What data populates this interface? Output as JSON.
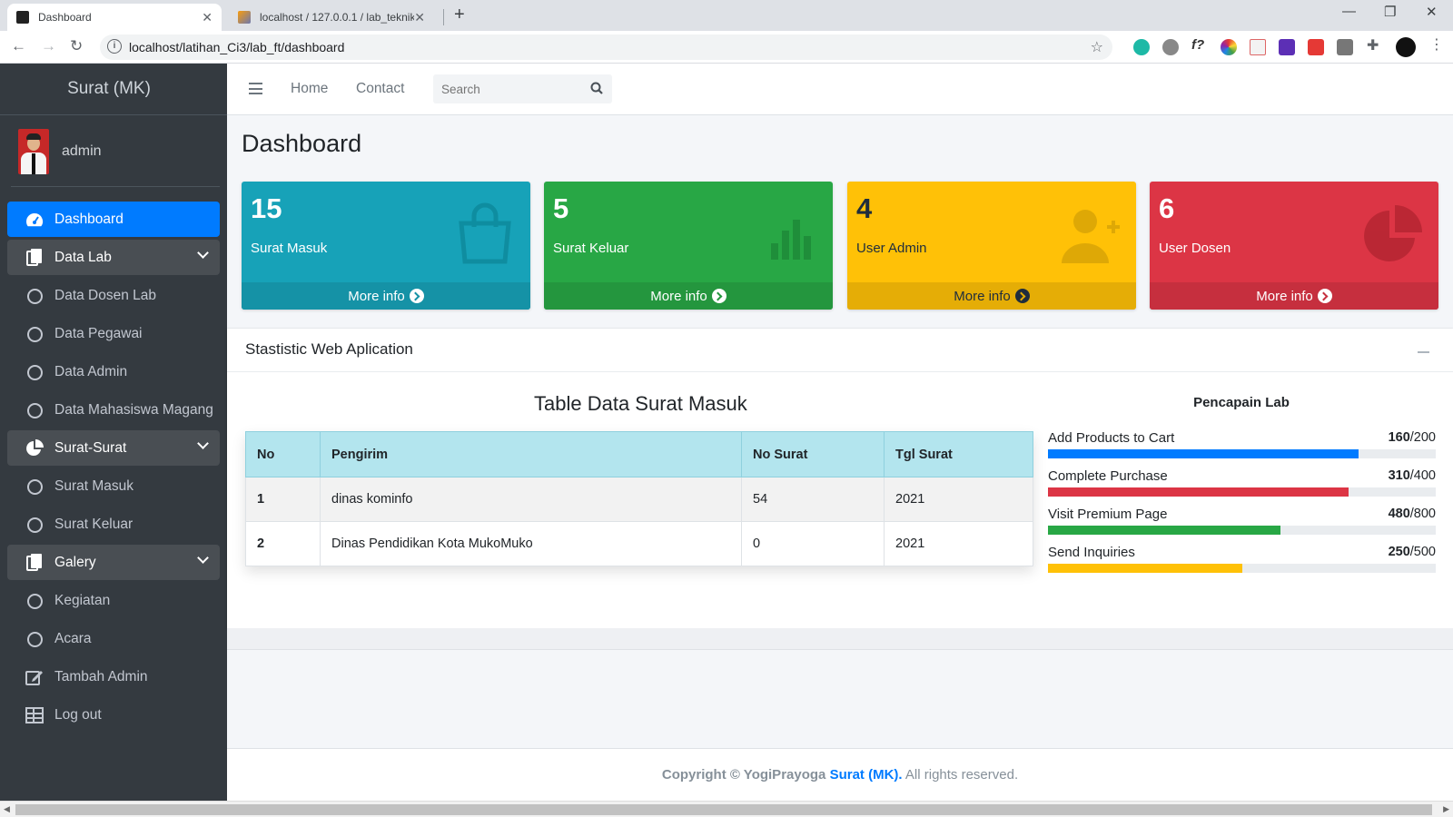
{
  "browser": {
    "tabs": [
      {
        "title": "Dashboard",
        "active": true
      },
      {
        "title": "localhost / 127.0.0.1 / lab_teknik",
        "active": false
      }
    ],
    "url": "localhost/latihan_Ci3/lab_ft/dashboard"
  },
  "sidebar": {
    "brand": "Surat (MK)",
    "user": "admin",
    "items": [
      {
        "label": "Dashboard",
        "icon": "tachometer-icon",
        "state": "active"
      },
      {
        "label": "Data Lab",
        "icon": "copy-icon",
        "state": "open"
      },
      {
        "label": "Data Dosen Lab",
        "icon": "circle-icon",
        "state": "sub"
      },
      {
        "label": "Data Pegawai",
        "icon": "circle-icon",
        "state": "sub"
      },
      {
        "label": "Data Admin",
        "icon": "circle-icon",
        "state": "sub"
      },
      {
        "label": "Data Mahasiswa Magang",
        "icon": "circle-icon",
        "state": "sub"
      },
      {
        "label": "Surat-Surat",
        "icon": "pie-chart-icon",
        "state": "open"
      },
      {
        "label": "Surat Masuk",
        "icon": "circle-icon",
        "state": "sub"
      },
      {
        "label": "Surat Keluar",
        "icon": "circle-icon",
        "state": "sub"
      },
      {
        "label": "Galery",
        "icon": "copy-icon",
        "state": "open"
      },
      {
        "label": "Kegiatan",
        "icon": "circle-icon",
        "state": "sub"
      },
      {
        "label": "Acara",
        "icon": "circle-icon",
        "state": "sub"
      },
      {
        "label": "Tambah Admin",
        "icon": "edit-icon",
        "state": "plain"
      },
      {
        "label": "Log out",
        "icon": "table-icon",
        "state": "plain"
      }
    ]
  },
  "topnav": {
    "home": "Home",
    "contact": "Contact",
    "search_placeholder": "Search"
  },
  "page_title": "Dashboard",
  "stat_boxes": [
    {
      "value": "15",
      "label": "Surat Masuk",
      "more": "More info",
      "color": "#17a2b8",
      "footer_color": "#1592a6",
      "icon": "shopping-bag-icon"
    },
    {
      "value": "5",
      "label": "Surat Keluar",
      "more": "More info",
      "color": "#28a745",
      "footer_color": "#24963e",
      "icon": "bar-chart-icon"
    },
    {
      "value": "4",
      "label": "User Admin",
      "more": "More info",
      "color": "#ffc107",
      "footer_color": "#e5ad06",
      "icon": "user-plus-icon"
    },
    {
      "value": "6",
      "label": "User Dosen",
      "more": "More info",
      "color": "#dc3545",
      "footer_color": "#c62f3e",
      "icon": "pie-chart-icon"
    }
  ],
  "card": {
    "title": "Stastistic Web Aplication",
    "table_title": "Table Data Surat Masuk",
    "columns": [
      "No",
      "Pengirim",
      "No Surat",
      "Tgl Surat"
    ],
    "rows": [
      [
        "1",
        "dinas kominfo",
        "54",
        "2021"
      ],
      [
        "2",
        "Dinas Pendidikan Kota MukoMuko",
        "0",
        "2021"
      ]
    ],
    "progress_title": "Pencapain Lab",
    "progress": [
      {
        "label": "Add Products to Cart",
        "value": "160",
        "max": "/200",
        "fraction": 0.8,
        "color": "#007bff"
      },
      {
        "label": "Complete Purchase",
        "value": "310",
        "max": "/400",
        "fraction": 0.775,
        "color": "#dc3545"
      },
      {
        "label": "Visit Premium Page",
        "value": "480",
        "max": "/800",
        "fraction": 0.6,
        "color": "#28a745"
      },
      {
        "label": "Send Inquiries",
        "value": "250",
        "max": "/500",
        "fraction": 0.5,
        "color": "#ffc107"
      }
    ]
  },
  "footer": {
    "copyright": "Copyright © YogiPrayoga",
    "brand": "Surat (MK).",
    "rights": "All rights reserved."
  }
}
